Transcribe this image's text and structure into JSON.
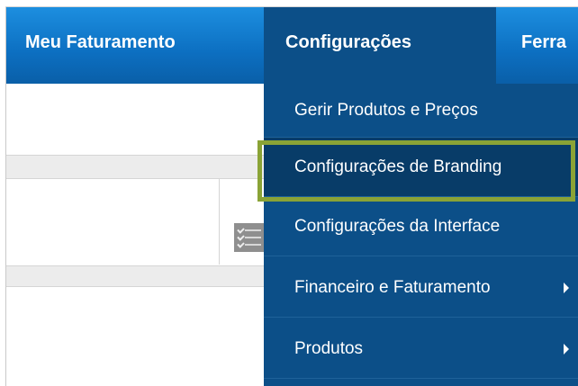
{
  "navbar": {
    "items": [
      {
        "label": "Meu Faturamento"
      },
      {
        "label": "Configurações"
      },
      {
        "label": "Ferra"
      }
    ]
  },
  "dropdown": {
    "items": [
      {
        "label": "Gerir Produtos e Preços",
        "has_submenu": false
      },
      {
        "label": "Configurações de Branding",
        "has_submenu": false,
        "highlighted": true
      },
      {
        "label": "Configurações da Interface",
        "has_submenu": false
      },
      {
        "label": "Financeiro e Faturamento",
        "has_submenu": true
      },
      {
        "label": "Produtos",
        "has_submenu": true
      }
    ]
  },
  "icons": {
    "list": "checklist-icon",
    "submenu": "caret-right-icon"
  },
  "colors": {
    "navbar": "#0c6fc1",
    "dropdown": "#0c4f88",
    "highlight_border": "#8aa336",
    "active_item": "#083c68"
  }
}
